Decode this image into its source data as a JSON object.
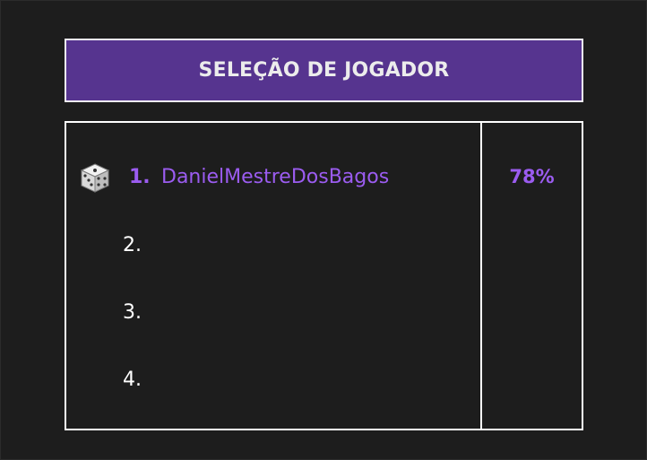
{
  "header": {
    "title": "SELEÇÃO DE JOGADOR"
  },
  "players": [
    {
      "number": "1.",
      "name": "DanielMestreDosBagos",
      "selected": true,
      "icon": "dice-icon"
    },
    {
      "number": "2.",
      "name": "",
      "selected": false
    },
    {
      "number": "3.",
      "name": "",
      "selected": false
    },
    {
      "number": "4.",
      "name": "",
      "selected": false
    }
  ],
  "percentage": "78%",
  "colors": {
    "background": "#1d1d1d",
    "header_bg": "#56348f",
    "accent": "#9b5cf0",
    "text": "#ffffff"
  }
}
